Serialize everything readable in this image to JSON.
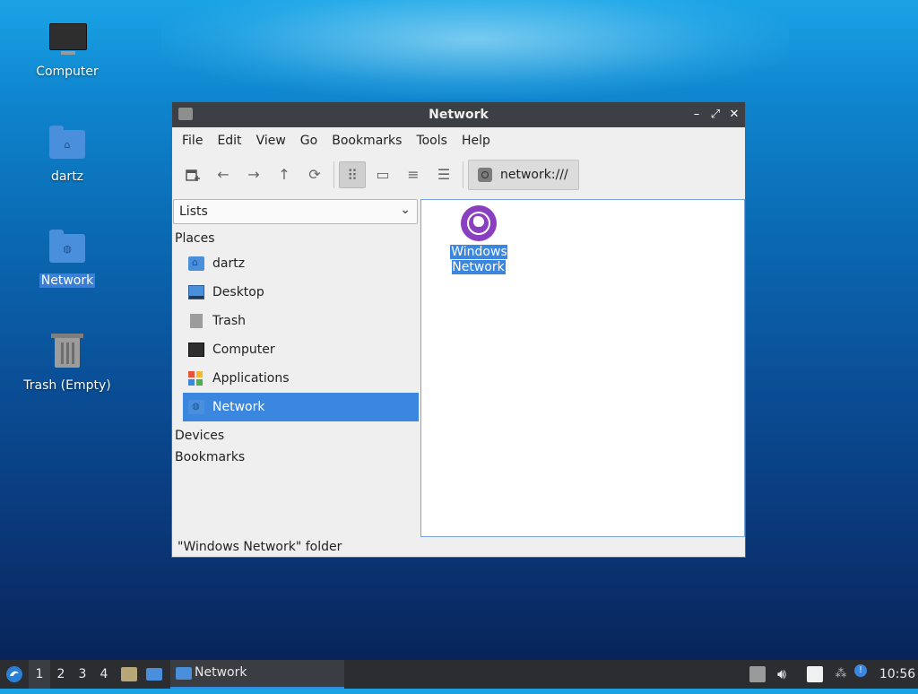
{
  "desktop": {
    "icons": [
      {
        "label": "Computer"
      },
      {
        "label": "dartz"
      },
      {
        "label": "Network"
      },
      {
        "label": "Trash (Empty)"
      }
    ]
  },
  "window": {
    "title": "Network",
    "controls": {
      "minimize": "–",
      "maximize": "⤢",
      "close": "✕"
    },
    "menu": [
      "File",
      "Edit",
      "View",
      "Go",
      "Bookmarks",
      "Tools",
      "Help"
    ],
    "toolbar": {
      "new_tab_icon": "new-tab-icon",
      "back": "←",
      "forward": "→",
      "up": "↑",
      "reload": "⟳",
      "icon_view": "⠿",
      "thumb_view": "▭",
      "compact_view": "≡",
      "detail_view": "☰",
      "path": "network:///"
    },
    "side_pane": {
      "mode": "Lists",
      "sections": {
        "places": "Places",
        "devices": "Devices",
        "bookmarks": "Bookmarks"
      },
      "places": [
        {
          "label": "dartz"
        },
        {
          "label": "Desktop"
        },
        {
          "label": "Trash"
        },
        {
          "label": "Computer"
        },
        {
          "label": "Applications"
        },
        {
          "label": "Network",
          "selected": true
        }
      ]
    },
    "content": {
      "items": [
        {
          "label_line1": "Windows",
          "label_line2": "Network",
          "selected": true
        }
      ]
    },
    "status": "\"Windows Network\" folder"
  },
  "taskbar": {
    "desktops": [
      "1",
      "2",
      "3",
      "4"
    ],
    "active_desktop": "1",
    "task": "Network",
    "clock": "10:56"
  },
  "colors": {
    "accent": "#3b87e0",
    "titlebar": "#3c3f44",
    "taskbar": "#2b2d30",
    "network_globe": "#8a3fc0"
  }
}
